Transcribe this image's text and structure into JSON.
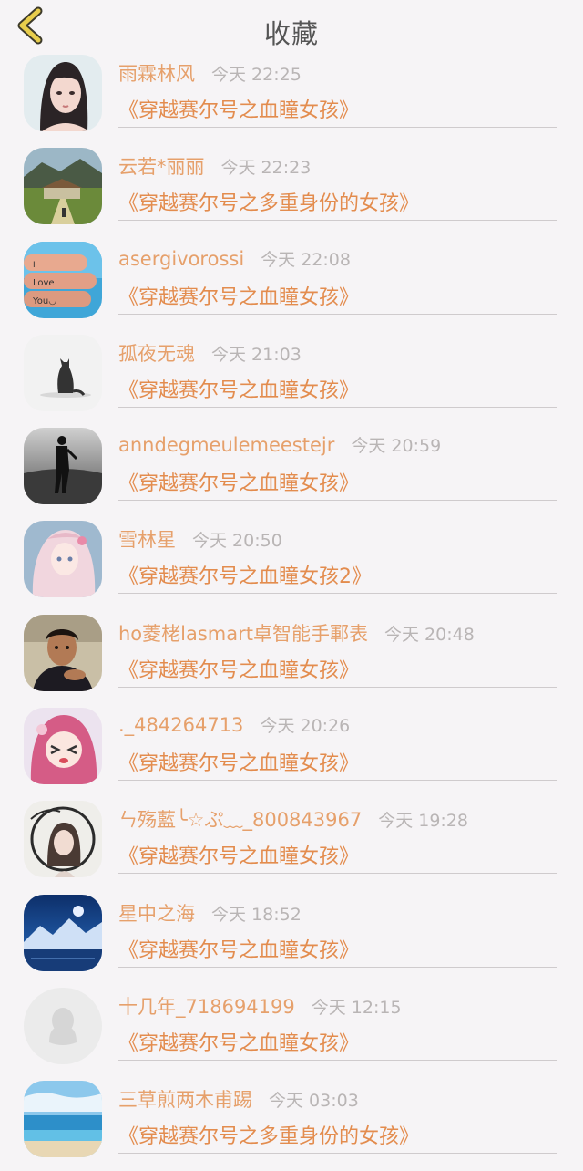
{
  "header": {
    "title": "收藏",
    "back_icon": "chevron-left-icon",
    "accent": "#e8cd4c"
  },
  "items": [
    {
      "name": "雨霖林风",
      "time": "今天 22:25",
      "book": "《穿越赛尔号之血瞳女孩》",
      "avatar": "anime-girl"
    },
    {
      "name": "云若*丽丽",
      "time": "今天 22:23",
      "book": "《穿越赛尔号之多重身份的女孩》",
      "avatar": "landscape-temple"
    },
    {
      "name": "asergivorossi",
      "time": "今天 22:08",
      "book": "《穿越赛尔号之血瞳女孩》",
      "avatar": "hand-love-you"
    },
    {
      "name": "孤夜无魂",
      "time": "今天 21:03",
      "book": "《穿越赛尔号之血瞳女孩》",
      "avatar": "black-cat"
    },
    {
      "name": "anndegmeulemeestejr",
      "time": "今天 20:59",
      "book": "《穿越赛尔号之血瞳女孩》",
      "avatar": "man-silhouette"
    },
    {
      "name": "雪林星",
      "time": "今天 20:50",
      "book": "《穿越赛尔号之血瞳女孩2》",
      "avatar": "anime-pastel"
    },
    {
      "name": "ho菱栳lasmart卓智能手鄆表",
      "time": "今天 20:48",
      "book": "《穿越赛尔号之血瞳女孩》",
      "avatar": "man-photo"
    },
    {
      "name": "._484264713",
      "time": "今天 20:26",
      "book": "《穿越赛尔号之血瞳女孩》",
      "avatar": "anime-pink"
    },
    {
      "name": "ㄣ殇藍╰☆ぷ﹏_800843967",
      "time": "今天 19:28",
      "book": "《穿越赛尔号之血瞳女孩》",
      "avatar": "girl-frame"
    },
    {
      "name": "星中之海",
      "time": "今天 18:52",
      "book": "《穿越赛尔号之血瞳女孩》",
      "avatar": "night-mountains"
    },
    {
      "name": "十几年_718694199",
      "time": "今天 12:15",
      "book": "《穿越赛尔号之血瞳女孩》",
      "avatar": "default-penguin"
    },
    {
      "name": "三草煎两木甫踢",
      "time": "今天 03:03",
      "book": "《穿越赛尔号之多重身份的女孩》",
      "avatar": "ocean"
    }
  ]
}
